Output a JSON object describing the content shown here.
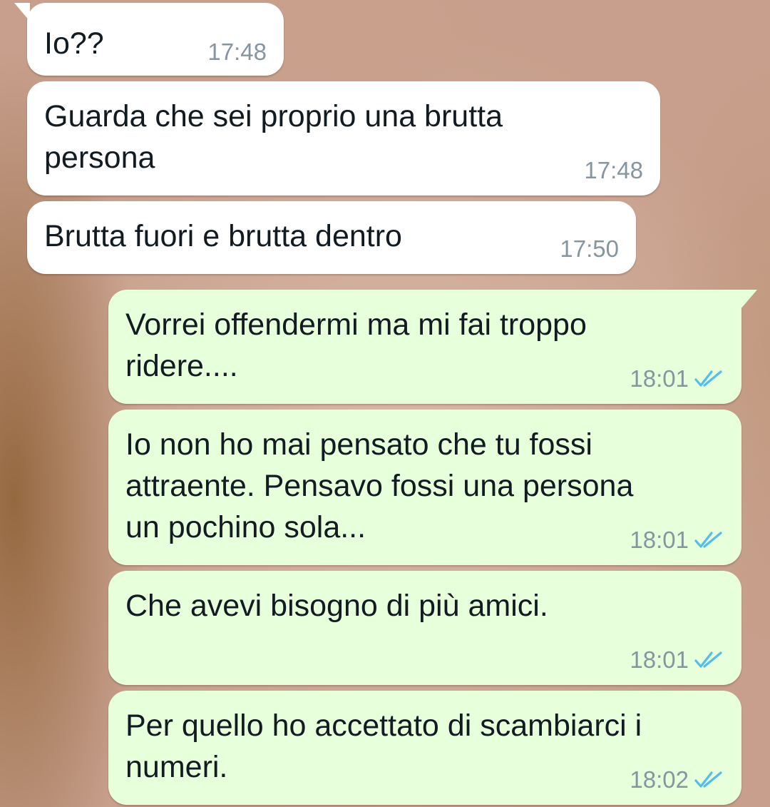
{
  "messages": [
    {
      "direction": "incoming",
      "text": "Io??",
      "time": "17:48"
    },
    {
      "direction": "incoming",
      "text": "Guarda che sei proprio una brutta\npersona",
      "time": "17:48"
    },
    {
      "direction": "incoming",
      "text": "Brutta fuori e brutta dentro",
      "time": "17:50"
    },
    {
      "direction": "outgoing",
      "text": "Vorrei offendermi ma mi fai troppo\nridere....",
      "time": "18:01",
      "status": "read-double-check-icon"
    },
    {
      "direction": "outgoing",
      "text": "Io non ho mai pensato che tu fossi\nattraente. Pensavo fossi una persona\nun pochino sola...",
      "time": "18:01",
      "status": "read-double-check-icon"
    },
    {
      "direction": "outgoing",
      "text": "Che avevi bisogno di più amici.",
      "time": "18:01",
      "status": "read-double-check-icon"
    },
    {
      "direction": "outgoing",
      "text": "Per quello ho accettato di scambiarci i\nnumeri.",
      "time": "18:02",
      "status": "read-double-check-icon"
    }
  ],
  "colors": {
    "incoming_bubble": "#ffffff",
    "outgoing_bubble": "#e7ffdb",
    "timestamp": "#8696a0",
    "read_ticks": "#53bdeb"
  }
}
